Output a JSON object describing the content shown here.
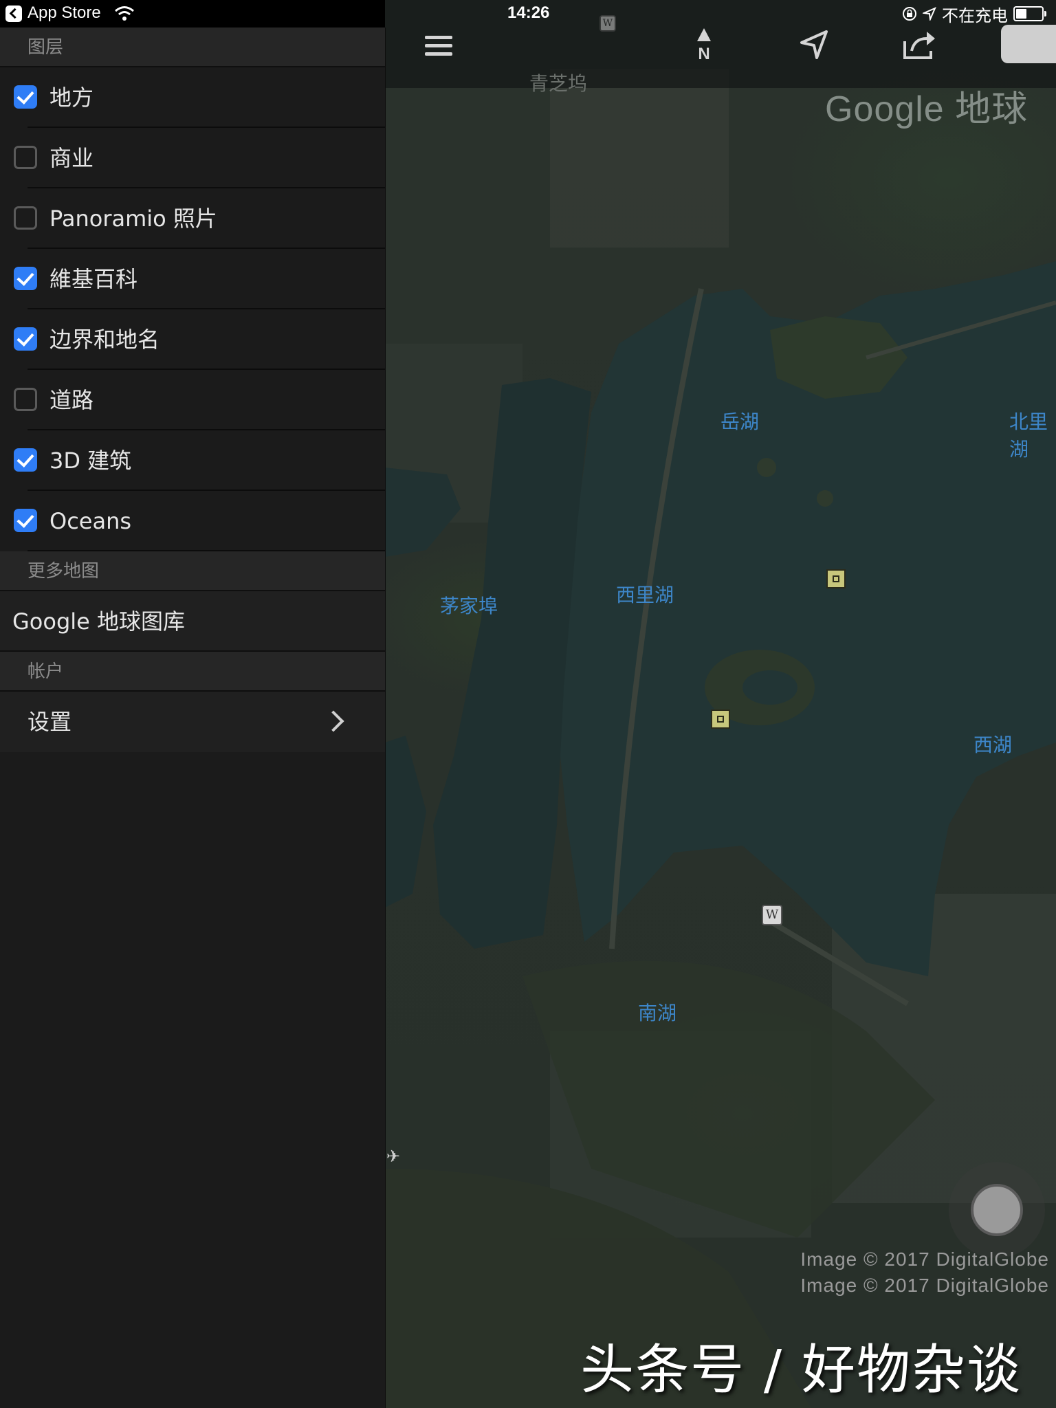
{
  "status_bar": {
    "back_app": "App Store",
    "time": "14:26",
    "charging_text": "不在充电",
    "battery_level": 0.45
  },
  "sidebar": {
    "layers_header": "图层",
    "layers": [
      {
        "label": "地方",
        "checked": true
      },
      {
        "label": "商业",
        "checked": false
      },
      {
        "label": "Panoramio 照片",
        "checked": false
      },
      {
        "label": "維基百科",
        "checked": true
      },
      {
        "label": "边界和地名",
        "checked": true
      },
      {
        "label": "道路",
        "checked": false
      },
      {
        "label": "3D 建筑",
        "checked": true
      },
      {
        "label": "Oceans",
        "checked": true
      }
    ],
    "more_maps_header": "更多地图",
    "gallery_label": "Google 地球图库",
    "account_header": "帐户",
    "settings_label": "设置"
  },
  "map": {
    "compass_letter": "N",
    "logo_text": "Google 地球",
    "places": {
      "qingzhi": "青芝坞",
      "yuehu": "岳湖",
      "beilihu": "北里湖",
      "maojiabu": "茅家埠",
      "xilihu": "西里湖",
      "xihu": "西湖",
      "nanhu": "南湖"
    },
    "attribution_1": "Image © 2017 DigitalGlobe",
    "attribution_2": "Image © 2017 DigitalGlobe",
    "wiki_marker": "W"
  },
  "watermark": "头条号 / 好物杂谈",
  "colors": {
    "accent_checkbox": "#2f7df6",
    "place_label": "#3d86c9",
    "sidebar_bg": "#1b1b1b"
  }
}
